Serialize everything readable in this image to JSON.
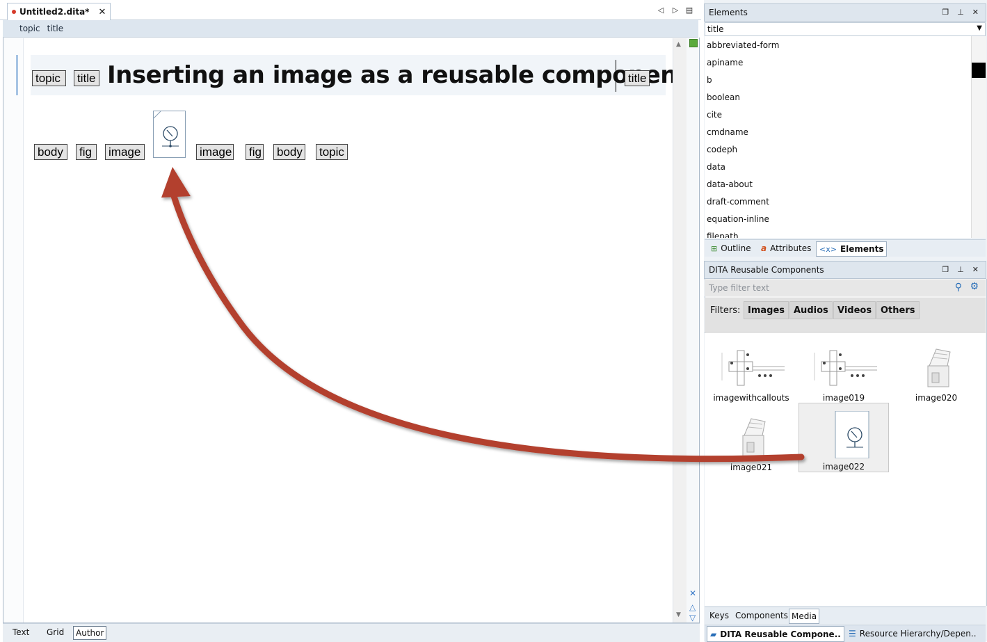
{
  "editor": {
    "tab_title": "Untitled2.dita*",
    "breadcrumb": [
      "topic",
      "title"
    ],
    "title_text": "Inserting an image as a reusable component",
    "tags": {
      "topic": "topic",
      "title": "title",
      "body": "body",
      "fig": "fig",
      "image": "image"
    },
    "modes": [
      "Text",
      "Grid",
      "Author"
    ],
    "active_mode": "Author"
  },
  "elements_panel": {
    "title": "Elements",
    "selected": "title",
    "items": [
      "abbreviated-form",
      "apiname",
      "b",
      "boolean",
      "cite",
      "cmdname",
      "codeph",
      "data",
      "data-about",
      "draft-comment",
      "equation-inline",
      "filepath"
    ],
    "tabs": [
      "Outline",
      "Attributes",
      "Elements"
    ],
    "active_tab": "Elements"
  },
  "components_panel": {
    "title": "DITA Reusable Components",
    "filter_placeholder": "Type filter text",
    "filters_label": "Filters:",
    "filters": [
      "Images",
      "Audios",
      "Videos",
      "Others"
    ],
    "media": [
      "imagewithcallouts",
      "image019",
      "image020",
      "image021",
      "image022"
    ],
    "selected_media": "image022",
    "tabs": [
      "Keys",
      "Components",
      "Media"
    ],
    "active_tab": "Media"
  },
  "view_tabs": [
    "DITA Reusable Compone..",
    "Resource Hierarchy/Depen.."
  ],
  "colors": {
    "arrow": "#b3402f",
    "modified_dot": "#d63b2b",
    "status_ok": "#5aaa3c"
  }
}
